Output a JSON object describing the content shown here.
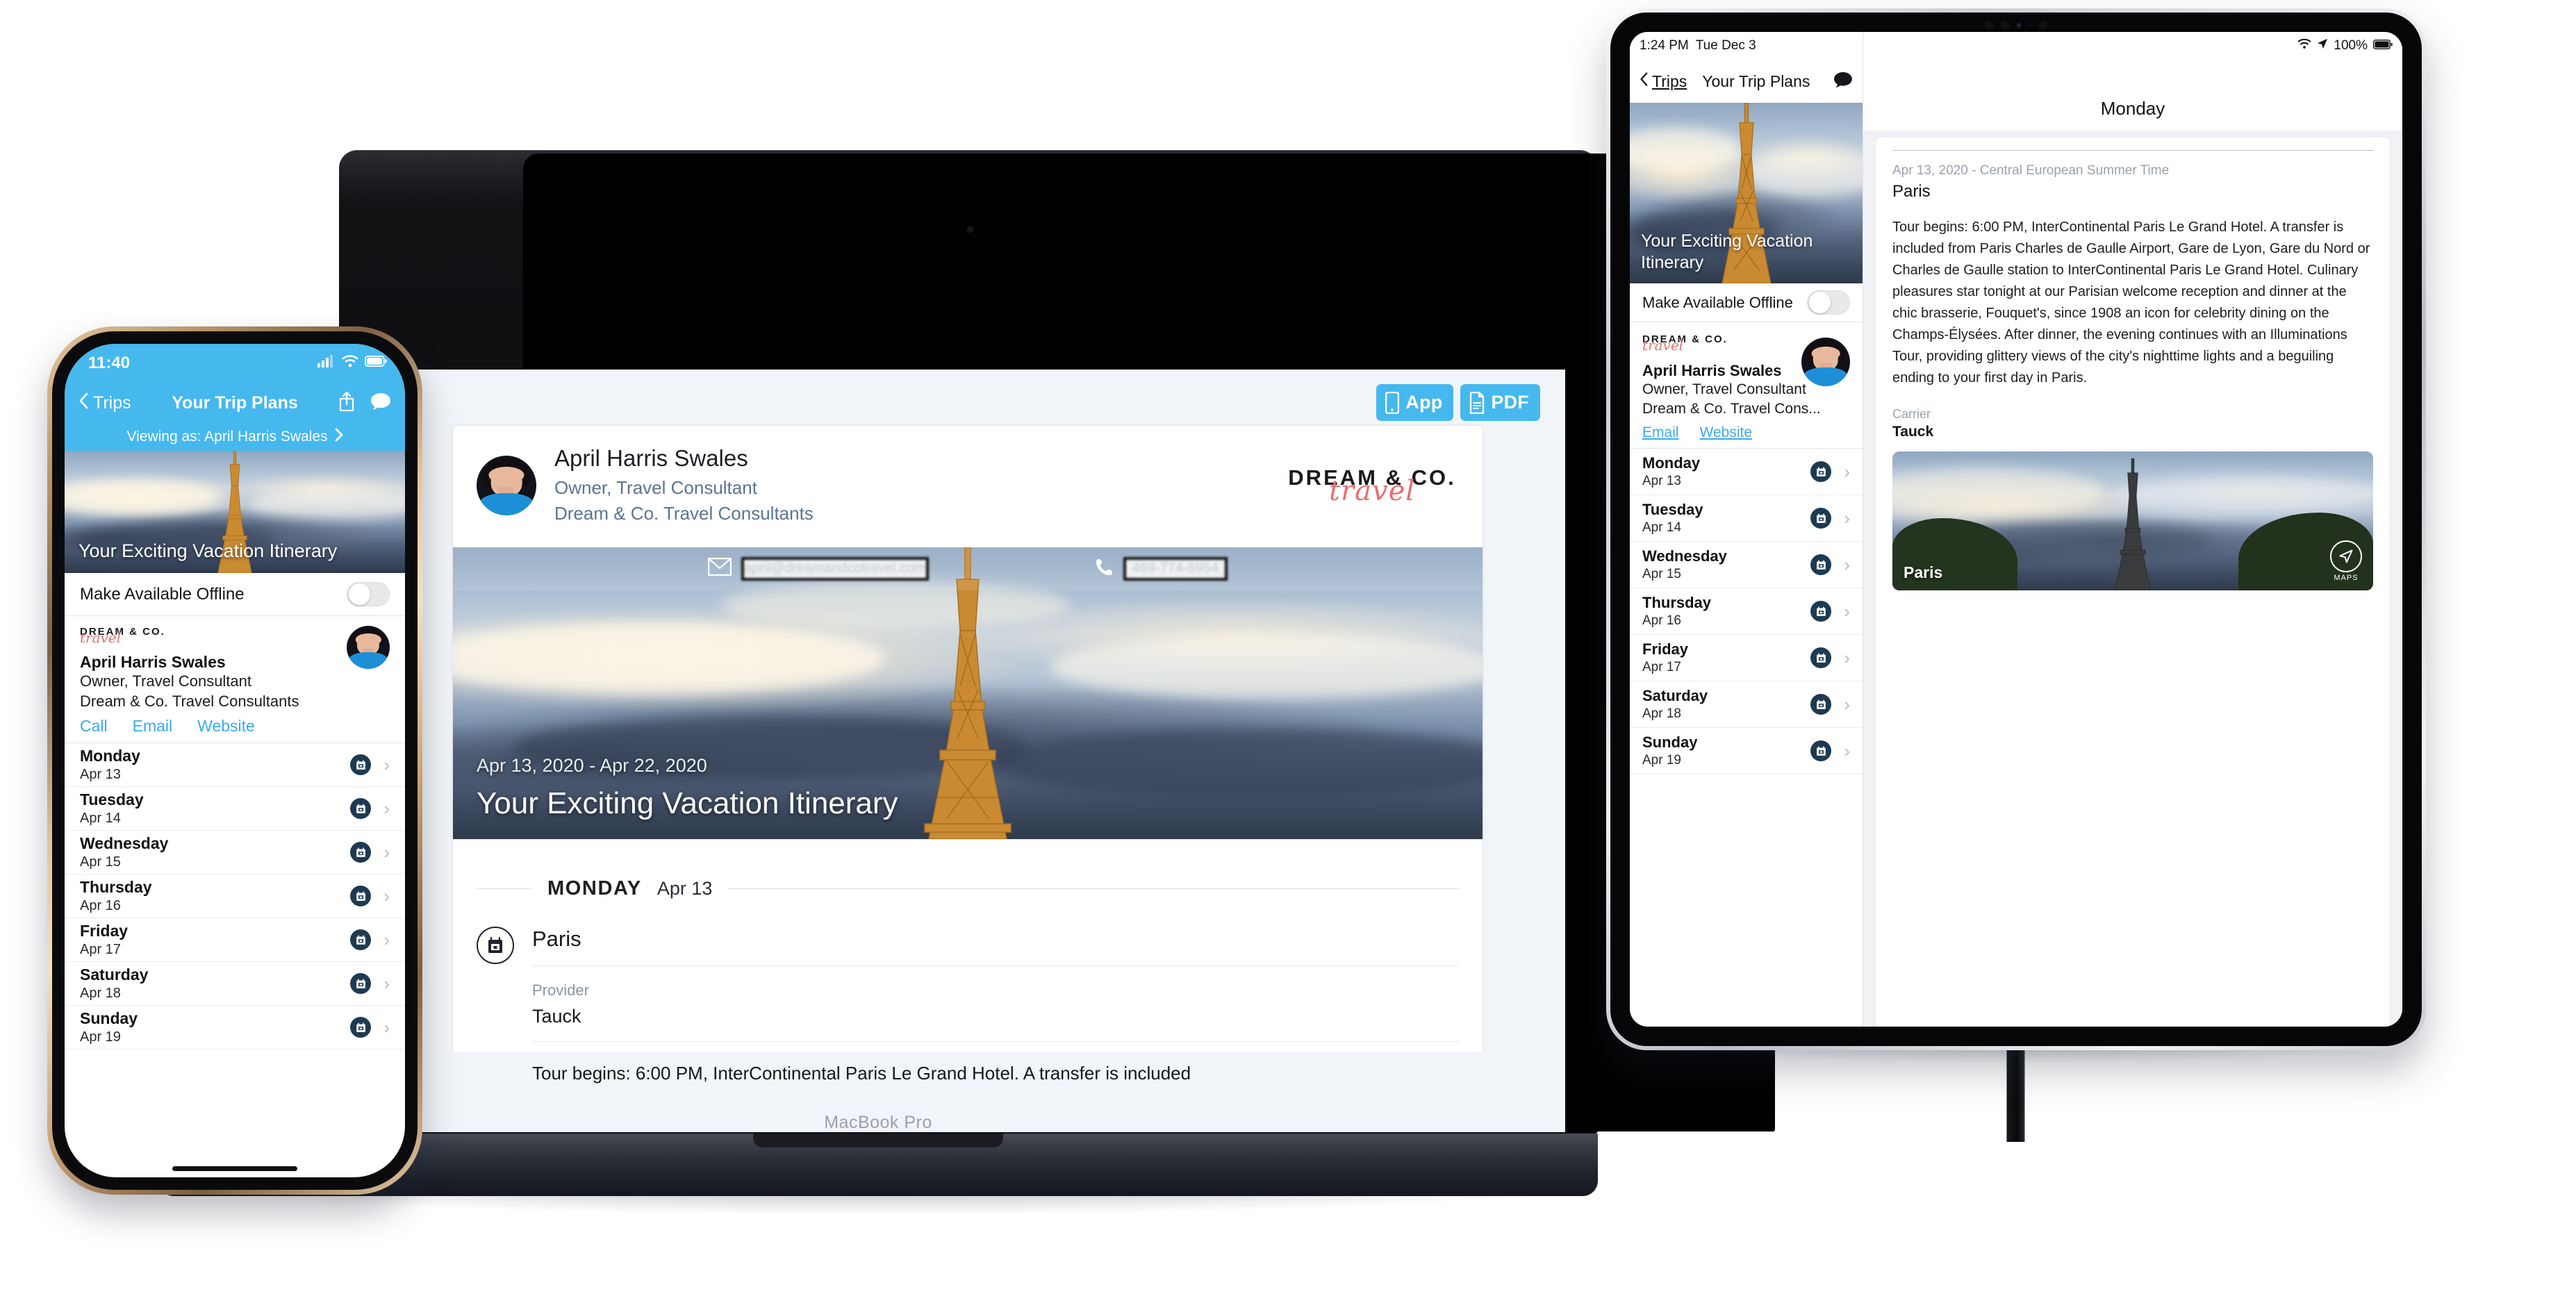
{
  "brand": {
    "logo_top": "DREAM & CO.",
    "logo_script": "travel",
    "accent_blue": "#45b8ee",
    "link_blue": "#3aa9f0",
    "badge_navy": "#1d3a52"
  },
  "agent": {
    "name": "April Harris Swales",
    "role": "Owner, Travel Consultant",
    "company": "Dream & Co. Travel Consultants",
    "company_truncated": "Dream & Co. Travel Cons...",
    "email_redacted": "april@dreamandcotravel.com",
    "phone_redacted": "469-774-6954"
  },
  "desktop": {
    "device_label": "MacBook Pro",
    "buttons": [
      {
        "label": "App",
        "icon": "phone-icon"
      },
      {
        "label": "PDF",
        "icon": "document-icon"
      }
    ],
    "hero": {
      "dates": "Apr 13, 2020 - Apr 22, 2020",
      "title": "Your Exciting Vacation Itinerary"
    },
    "day": {
      "dow": "MONDAY",
      "date": "Apr 13",
      "segment_title": "Paris",
      "segment_icon": "calendar-icon",
      "fields": [
        {
          "key": "Provider",
          "value": "Tauck"
        }
      ],
      "description": "Tour begins: 6:00 PM, InterContinental Paris Le Grand Hotel. A transfer is included"
    }
  },
  "phone": {
    "status": {
      "time": "11:40",
      "signal": "signal-icon",
      "wifi": "wifi-icon",
      "battery": "battery-icon"
    },
    "nav": {
      "back": "Trips",
      "title": "Your Trip Plans",
      "share": "share-icon",
      "chat": "chat-icon"
    },
    "viewing_as": "Viewing as: April Harris Swales",
    "hero_title": "Your Exciting Vacation Itinerary",
    "offline_label": "Make Available Offline",
    "offline_on": false,
    "links": [
      "Call",
      "Email",
      "Website"
    ],
    "days": [
      {
        "dow": "Monday",
        "date": "Apr 13"
      },
      {
        "dow": "Tuesday",
        "date": "Apr 14"
      },
      {
        "dow": "Wednesday",
        "date": "Apr 15"
      },
      {
        "dow": "Thursday",
        "date": "Apr 16"
      },
      {
        "dow": "Friday",
        "date": "Apr 17"
      },
      {
        "dow": "Saturday",
        "date": "Apr 18"
      },
      {
        "dow": "Sunday",
        "date": "Apr 19"
      }
    ]
  },
  "tablet": {
    "status": {
      "time": "1:24 PM",
      "date": "Tue Dec 3",
      "wifi": "wifi-icon",
      "location": "location-arrow-icon",
      "battery_pct": "100%",
      "battery": "battery-icon"
    },
    "nav": {
      "back": "Trips",
      "title": "Your Trip Plans",
      "chat": "chat-icon"
    },
    "detail_title": "Monday",
    "hero_title": "Your Exciting Vacation Itinerary",
    "offline_label": "Make Available Offline",
    "offline_on": false,
    "links": [
      "Email",
      "Website"
    ],
    "days": [
      {
        "dow": "Monday",
        "date": "Apr 13"
      },
      {
        "dow": "Tuesday",
        "date": "Apr 14"
      },
      {
        "dow": "Wednesday",
        "date": "Apr 15"
      },
      {
        "dow": "Thursday",
        "date": "Apr 16"
      },
      {
        "dow": "Friday",
        "date": "Apr 17"
      },
      {
        "dow": "Saturday",
        "date": "Apr 18"
      },
      {
        "dow": "Sunday",
        "date": "Apr 19"
      }
    ],
    "detail": {
      "timezone_line": "Apr 13, 2020 - Central European Summer Time",
      "city": "Paris",
      "description": "Tour begins: 6:00 PM, InterContinental Paris Le Grand Hotel. A transfer is included from Paris Charles de Gaulle Airport, Gare de Lyon, Gare du Nord or Charles de Gaulle station to InterContinental Paris Le Grand Hotel. Culinary pleasures star tonight at our Parisian welcome reception and dinner at the chic brasserie, Fouquet's, since 1908 an icon for celebrity dining on the Champs-Élysées. After dinner, the evening continues with an Illuminations Tour, providing glittery views of the city's nighttime lights and a beguiling ending to your first day in Paris.",
      "carrier_key": "Carrier",
      "carrier_value": "Tauck",
      "photo_caption": "Paris",
      "maps_label": "MAPS"
    }
  }
}
